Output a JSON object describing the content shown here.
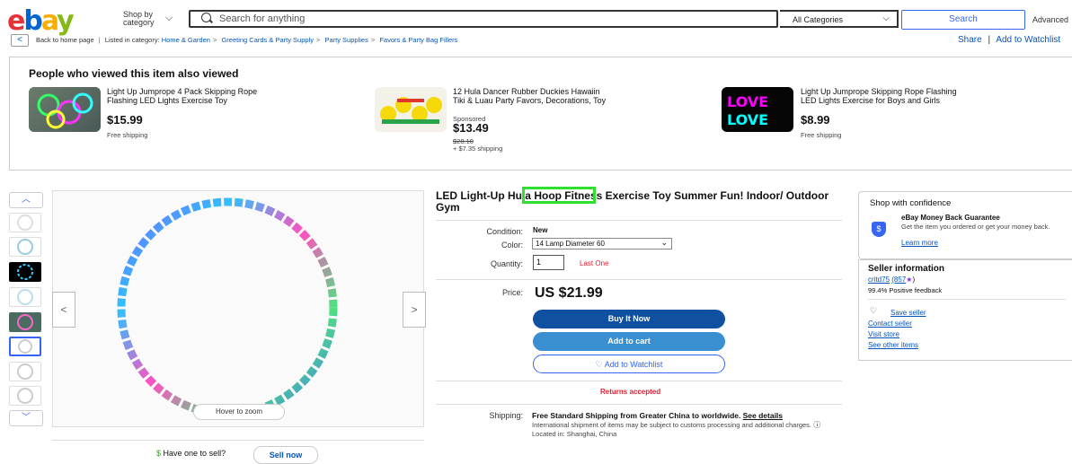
{
  "header": {
    "shop_by": "Shop by category",
    "search_placeholder": "Search for anything",
    "category": "All Categories",
    "search_button": "Search",
    "advanced": "Advanced"
  },
  "breadcrumb": {
    "back": "Back to home page",
    "listed_in": "Listed in category:",
    "items": [
      "Home & Garden",
      "Greeting Cards & Party Supply",
      "Party Supplies",
      "Favors & Party Bag Fillers"
    ],
    "share": "Share",
    "watchlist": "Add to Watchlist"
  },
  "also_viewed": {
    "title": "People who viewed this item also viewed",
    "items": [
      {
        "title": "Light Up Jumprope 4 Pack Skipping Rope Flashing LED Lights Exercise Toy",
        "price": "$15.99",
        "shipping": "Free shipping",
        "sponsored": "",
        "was": ""
      },
      {
        "title": "12 Hula Dancer Rubber Duckies Hawaiin Tiki & Luau Party Favors, Decorations, Toy",
        "price": "$13.49",
        "shipping": "+ $7.35 shipping",
        "sponsored": "Sponsored",
        "was": "$28.10"
      },
      {
        "title": "Light Up Jumprope Skipping Rope Flashing LED Lights Exercise for Boys and Girls",
        "price": "$8.99",
        "shipping": "Free shipping",
        "sponsored": "",
        "was": ""
      }
    ]
  },
  "gallery": {
    "zoom_hint": "Hover to zoom",
    "sell_prompt": "Have one to sell?",
    "sell_now": "Sell now"
  },
  "product": {
    "title": "LED Light-Up Hula Hoop Fitness Exercise Toy Summer Fun! Indoor/ Outdoor Gym",
    "condition_label": "Condition:",
    "condition": "New",
    "color_label": "Color:",
    "color_value": "14 Lamp Diameter 60",
    "quantity_label": "Quantity:",
    "quantity": "1",
    "stock_note": "Last One",
    "price_label": "Price:",
    "price": "US $21.99",
    "buy_now": "Buy It Now",
    "add_to_cart": "Add to cart",
    "add_to_watchlist": "Add to Watchlist",
    "returns": "Returns accepted",
    "shipping_label": "Shipping:",
    "shipping": "Free Standard Shipping from Greater China to worldwide.",
    "see_details": "See details",
    "intl_note": "International shipment of items may be subject to customs processing and additional charges.",
    "located": "Located in: Shanghai, China"
  },
  "confidence": {
    "title": "Shop with confidence",
    "guarantee": "eBay Money Back Guarantee",
    "guarantee_text": "Get the item you ordered or get your money back.",
    "learn_more": "Learn more"
  },
  "seller": {
    "title": "Seller information",
    "name": "critd75",
    "score": "(857",
    "feedback": "99.4% Positive feedback",
    "save": "Save seller",
    "contact": "Contact seller",
    "visit": "Visit store",
    "see_items": "See other items"
  }
}
